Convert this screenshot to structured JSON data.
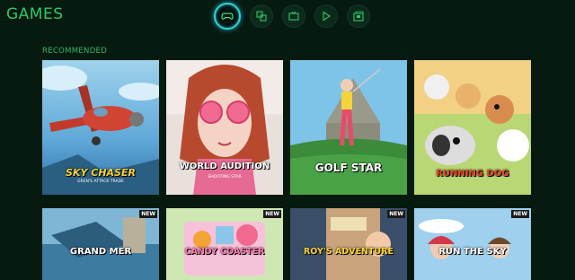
{
  "header": {
    "title": "GAMES"
  },
  "tabs": [
    {
      "name": "tab-games",
      "icon": "gamepad-icon",
      "active": true
    },
    {
      "name": "tab-apps",
      "icon": "apps-icon",
      "active": false
    },
    {
      "name": "tab-tv",
      "icon": "tv-icon",
      "active": false
    },
    {
      "name": "tab-video",
      "icon": "play-icon",
      "active": false
    },
    {
      "name": "tab-media",
      "icon": "media-icon",
      "active": false
    }
  ],
  "section": {
    "title": "RECOMMENDED"
  },
  "games": [
    {
      "title": "SKY CHASER",
      "subtitle": "GREN'S ATTACK TRADE",
      "badge": ""
    },
    {
      "title": "WORLD AUDITION",
      "subtitle": "SHOOTING STAR",
      "badge": ""
    },
    {
      "title": "GOLF STAR",
      "subtitle": "",
      "badge": ""
    },
    {
      "title": "RUNNING DOG",
      "subtitle": "",
      "badge": ""
    },
    {
      "title": "GRAND MER",
      "subtitle": "",
      "badge": "NEW"
    },
    {
      "title": "CANDY COASTER",
      "subtitle": "",
      "badge": "NEW"
    },
    {
      "title": "ROY'S ADVENTURE",
      "subtitle": "",
      "badge": "NEW"
    },
    {
      "title": "RUN THE SKY",
      "subtitle": "",
      "badge": "NEW"
    }
  ],
  "colors": {
    "background": "#061a10",
    "accent": "#2fc86a",
    "active_ring": "#2fd6c0"
  }
}
